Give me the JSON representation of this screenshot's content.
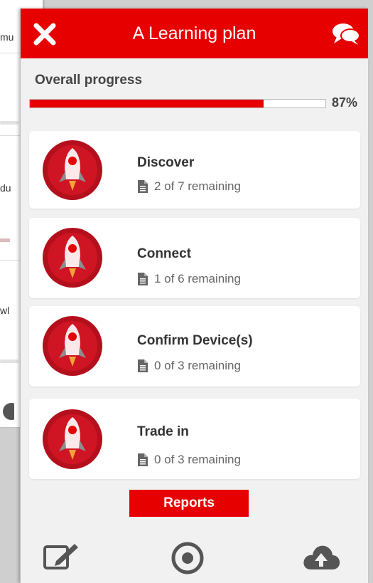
{
  "background": {
    "fragments": [
      "mu",
      "du",
      "wl"
    ]
  },
  "header": {
    "title": "A Learning plan",
    "close_icon": "close-icon",
    "chat_icon": "chat-icon",
    "color": "#e60000"
  },
  "progress": {
    "label": "Overall progress",
    "percent_text": "87%",
    "fraction": 0.79
  },
  "modules": [
    {
      "title": "Discover",
      "remaining": "2 of 7 remaining"
    },
    {
      "title": "Connect",
      "remaining": "1 of 6 remaining"
    },
    {
      "title": "Confirm Device(s)",
      "remaining": "0 of 3 remaining"
    },
    {
      "title": "Trade in",
      "remaining": "0 of 3 remaining"
    }
  ],
  "reports": {
    "label": "Reports"
  },
  "bottom_bar": {
    "icons": [
      "edit-icon",
      "target-icon",
      "cloud-upload-icon"
    ]
  }
}
